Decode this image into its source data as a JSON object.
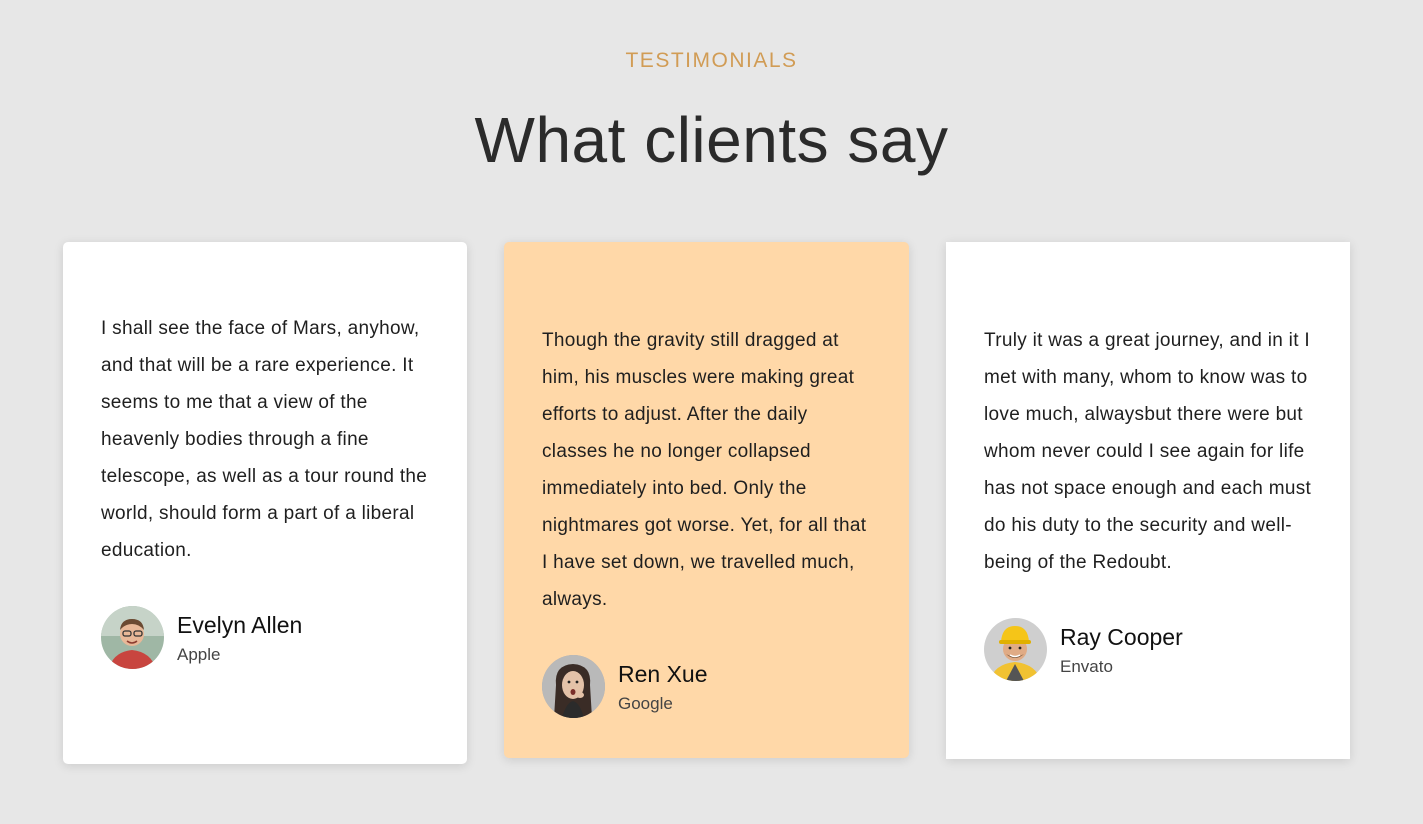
{
  "header": {
    "eyebrow": "TESTIMONIALS",
    "title": "What clients say"
  },
  "colors": {
    "background": "#e7e7e7",
    "accent": "#d19c55",
    "highlight_card": "#ffd8a8",
    "card": "#ffffff"
  },
  "testimonials": [
    {
      "quote": "I shall see the face of Mars, anyhow, and that will be a rare experience. It seems to me that a view of the heavenly bodies through a fine telescope, as well as a tour round the world, should form a part of a liberal education.",
      "name": "Evelyn Allen",
      "company": "Apple",
      "avatar_icon": "avatar-man-glasses"
    },
    {
      "quote": "Though the gravity still dragged at him, his muscles were making great efforts to adjust. After the daily classes he no longer collapsed immediately into bed. Only the nightmares got worse. Yet, for all that I have set down, we travelled much, always.",
      "name": "Ren Xue",
      "company": "Google",
      "avatar_icon": "avatar-woman-surprised"
    },
    {
      "quote": "Truly it was a great journey, and in it I met with many, whom to know was to love much, alwaysbut there were but whom never could I see again for life has not space enough and each must do his duty to the security and well-being of the Redoubt.",
      "name": "Ray Cooper",
      "company": "Envato",
      "avatar_icon": "avatar-man-hardhat"
    }
  ]
}
